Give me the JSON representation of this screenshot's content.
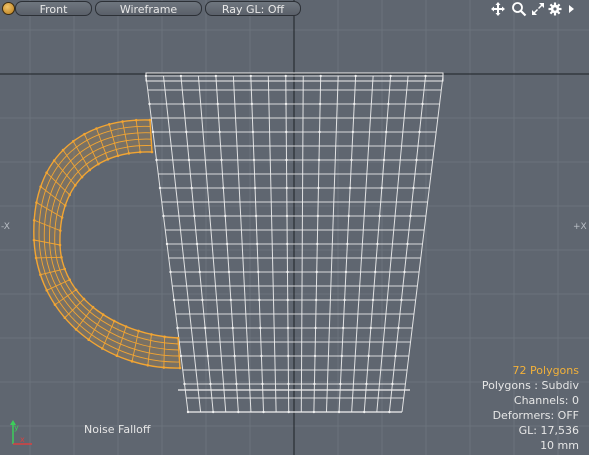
{
  "toolbar": {
    "view_label": "Front",
    "shading_label": "Wireframe",
    "raygl_label": "Ray GL: Off"
  },
  "axes": {
    "left_label": "-X",
    "right_label": "+X"
  },
  "hud": {
    "polygons_selected": "72 Polygons",
    "polygon_mode": "Polygons : Subdiv",
    "channels": "Channels: 0",
    "deformers": "Deformers: OFF",
    "gl_count": "GL: 17,536",
    "grid_size": "10 mm"
  },
  "falloff_label": "Noise Falloff",
  "icons": [
    "menu-dot-icon",
    "move-view-icon",
    "zoom-view-icon",
    "maximize-view-icon",
    "gear-icon",
    "arrow-right-icon"
  ],
  "colors": {
    "background": "#5f6670",
    "grid": "#6b737c",
    "axis": "#1e2226",
    "wire": "#f0f0f0",
    "selection": "#f2a533",
    "hud_highlight": "#f2b13a"
  }
}
